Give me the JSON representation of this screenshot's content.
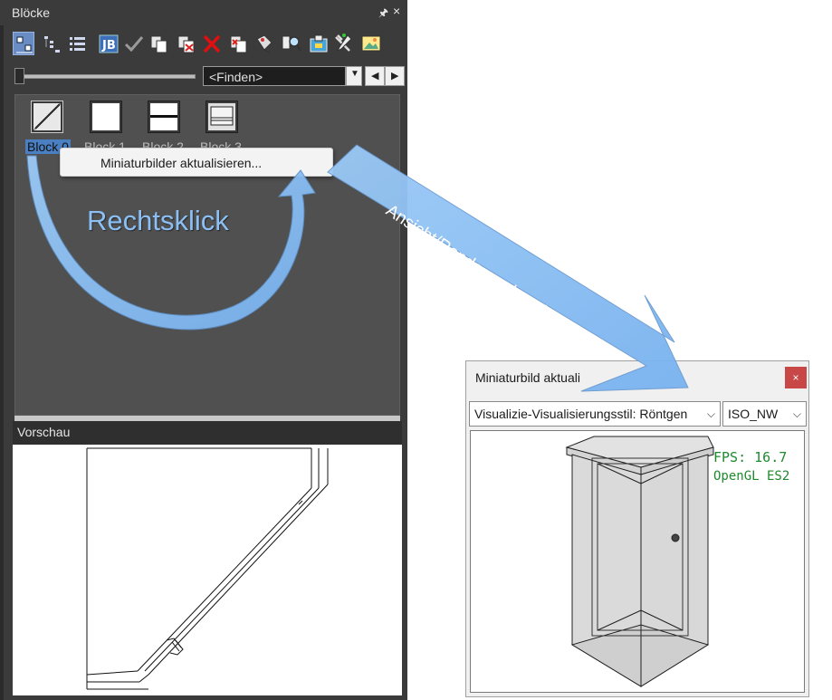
{
  "panel": {
    "title": "Blöcke",
    "pin_icon": "pin-icon",
    "close_glyph": "×",
    "toolbar_icons": [
      "show-thumbnails-icon",
      "tree-view-icon",
      "list-view-icon",
      "insert-block-icon",
      "checkmark-icon",
      "copy-block-icon",
      "delete-block-copy-icon",
      "delete-icon",
      "rename-block-icon",
      "attribute-icon",
      "find-block-icon",
      "export-block-icon",
      "tools-icon",
      "image-icon"
    ],
    "find_placeholder": "<Finden>",
    "blocks": [
      {
        "label": "Block 0"
      },
      {
        "label": "Block 1"
      },
      {
        "label": "Block 2"
      },
      {
        "label": "Block 3"
      }
    ],
    "context_menu": {
      "item": "Miniaturbilder aktualisieren..."
    },
    "preview_title": "Vorschau"
  },
  "dialog": {
    "title": "Miniaturbild aktuali",
    "close_glyph": "×",
    "style_value": "Visualizie-Visualisierungsstil: Röntgen",
    "view_value": "ISO_NW",
    "fps": "FPS:  16.7",
    "renderer": "OpenGL ES2"
  },
  "annotations": {
    "rechtsklick": "Rechtsklick",
    "ansicht": "Ansicht/Rendermodus einstellen",
    "arrow_color": "#8cc0f5"
  }
}
